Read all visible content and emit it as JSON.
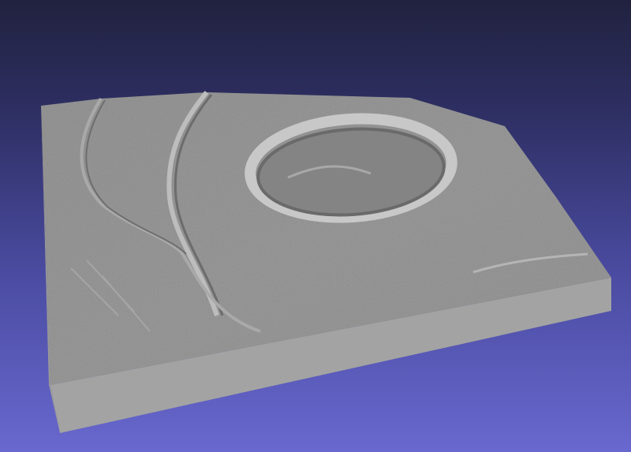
{
  "viewport": {
    "background_top": "#21223f",
    "background_bottom": "#6868cf",
    "model_color": "#8f8f8f",
    "side_color": "#a4a4a4"
  }
}
